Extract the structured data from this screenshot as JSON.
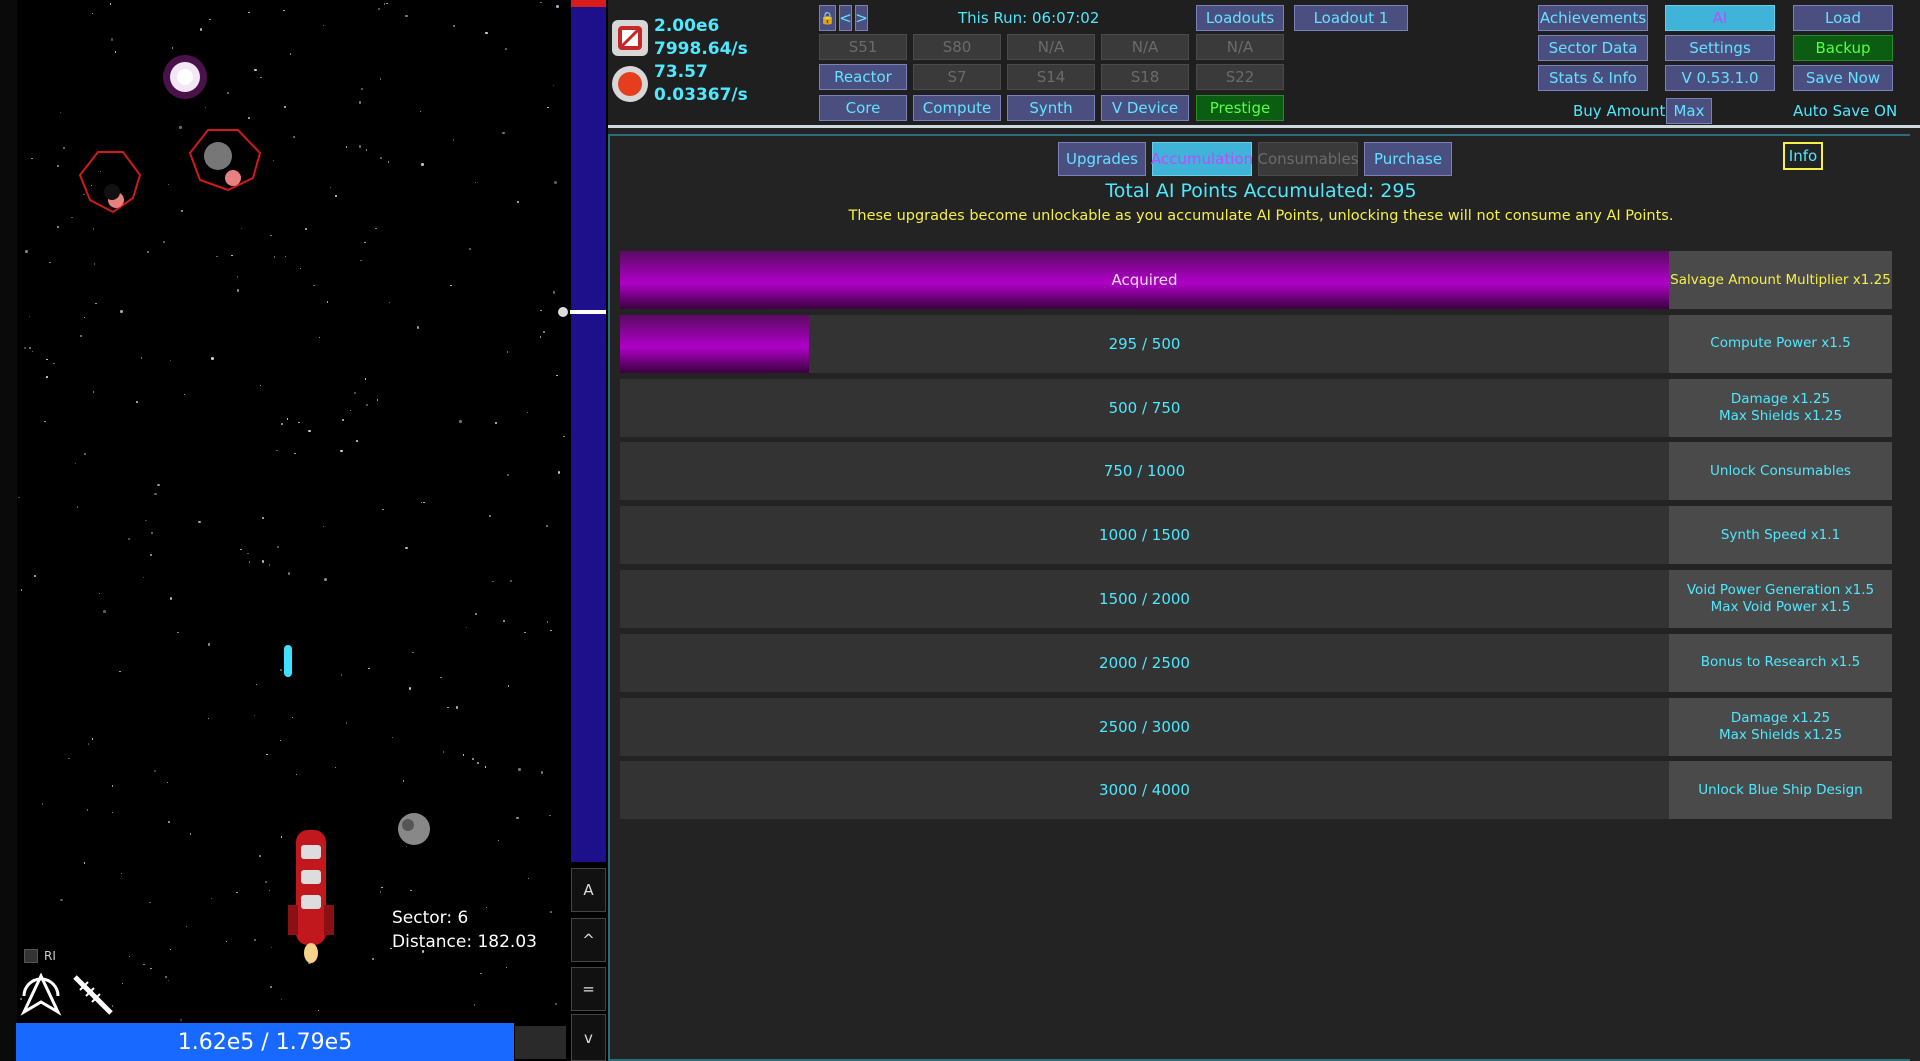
{
  "game": {
    "sector_label": "Sector: 6",
    "distance_label": "Distance: 182.03",
    "hp_text": "1.62e5 / 1.79e5",
    "hp_fraction": 0.905,
    "ri_label": "RI",
    "side_buttons": [
      "A",
      "^",
      "=",
      "v"
    ]
  },
  "resources": {
    "top_value": "2.00e6",
    "top_rate": "7998.64/s",
    "bottom_value": "73.57",
    "bottom_rate": "0.03367/s"
  },
  "topbar": {
    "lock_icon": "lock-icon",
    "prev_label": "<",
    "next_label": ">",
    "run_time": "This Run: 06:07:02",
    "slots_row1": [
      "S51",
      "S80",
      "N/A",
      "N/A",
      "N/A"
    ],
    "slots_row2_first": "Reactor",
    "slots_row2": [
      "S7",
      "S14",
      "S18",
      "S22"
    ],
    "tabs_row": [
      "Core",
      "Compute",
      "Synth",
      "V Device",
      "Prestige"
    ],
    "loadouts_label": "Loadouts",
    "loadout1_label": "Loadout 1",
    "achievements_label": "Achievements",
    "ai_label": "AI",
    "load_label": "Load",
    "sector_data_label": "Sector Data",
    "settings_label": "Settings",
    "backup_label": "Backup",
    "stats_label": "Stats & Info",
    "version_label": "V 0.53.1.0",
    "save_now_label": "Save Now",
    "buy_amount_label": "Buy Amount:",
    "buy_amount_value": "Max",
    "autosave_label": "Auto Save ON"
  },
  "main": {
    "tabs": [
      "Upgrades",
      "Accumulation",
      "Consumables",
      "Purchase"
    ],
    "info_label": "Info",
    "total_label": "Total AI Points Accumulated: 295",
    "description": "These upgrades become unlockable as you accumulate AI Points, unlocking these will not consume any AI Points.",
    "rows": [
      {
        "progress": "Acquired",
        "fraction": 1.0,
        "reward": [
          "Salvage Amount Multiplier x1.25"
        ],
        "acquired": true
      },
      {
        "progress": "295 / 500",
        "fraction": 0.18,
        "reward": [
          "Compute Power x1.5"
        ],
        "acquired": false
      },
      {
        "progress": "500 / 750",
        "fraction": 0,
        "reward": [
          "Damage x1.25",
          "Max Shields x1.25"
        ],
        "acquired": false
      },
      {
        "progress": "750 / 1000",
        "fraction": 0,
        "reward": [
          "Unlock Consumables"
        ],
        "acquired": false
      },
      {
        "progress": "1000 / 1500",
        "fraction": 0,
        "reward": [
          "Synth Speed x1.1"
        ],
        "acquired": false
      },
      {
        "progress": "1500 / 2000",
        "fraction": 0,
        "reward": [
          "Void Power Generation x1.5",
          "Max Void Power x1.5"
        ],
        "acquired": false
      },
      {
        "progress": "2000 / 2500",
        "fraction": 0,
        "reward": [
          "Bonus to Research x1.5"
        ],
        "acquired": false
      },
      {
        "progress": "2500 / 3000",
        "fraction": 0,
        "reward": [
          "Damage x1.25",
          "Max Shields x1.25"
        ],
        "acquired": false
      },
      {
        "progress": "3000 / 4000",
        "fraction": 0,
        "reward": [
          "Unlock Blue Ship Design"
        ],
        "acquired": false
      }
    ]
  },
  "colors": {
    "accent_cyan": "#4ee8ff",
    "button_bg": "#4a4f80",
    "progress_purple": "#b000c8",
    "reward_yellow": "#f5f04a",
    "hp_blue": "#1769ff"
  }
}
